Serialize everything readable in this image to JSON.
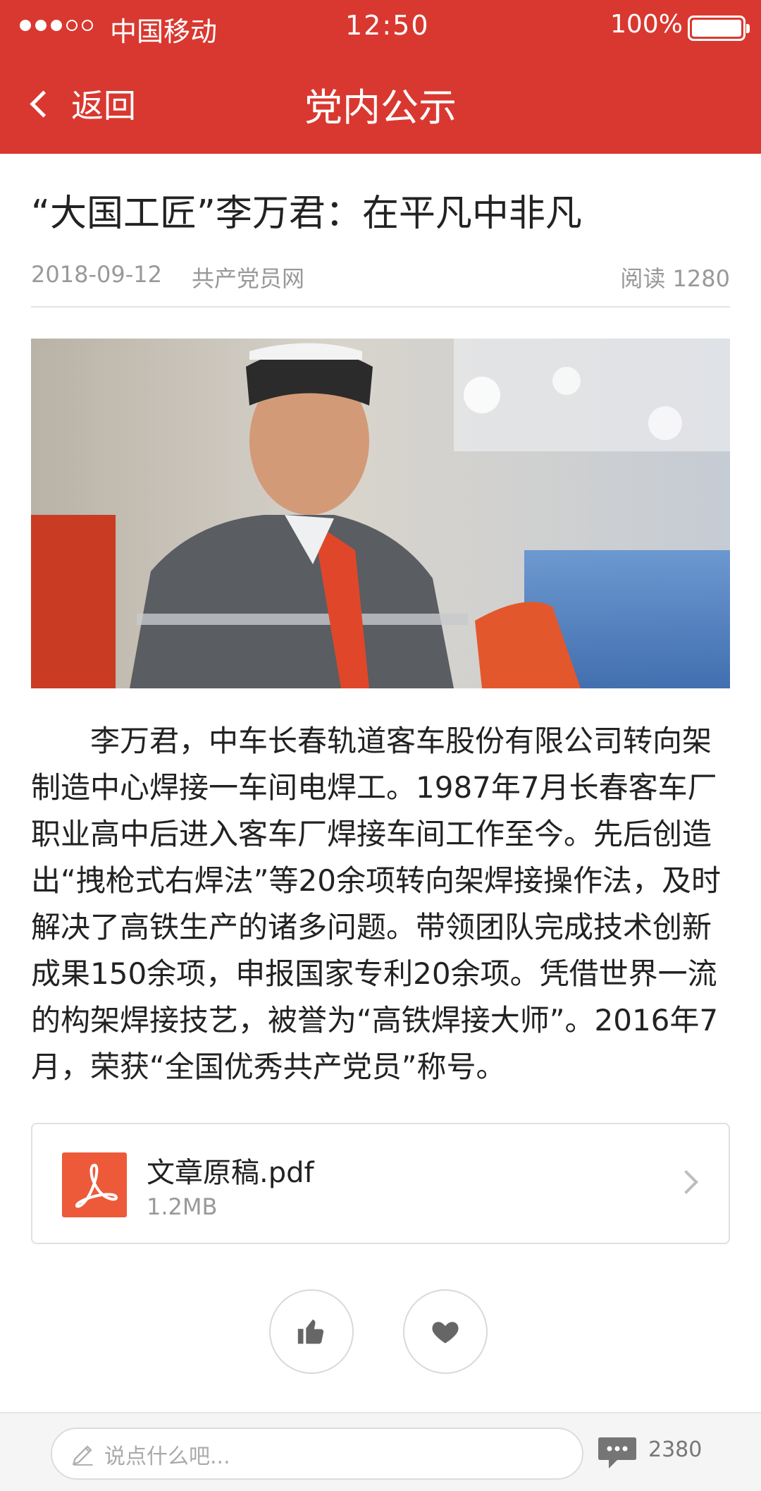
{
  "status_bar": {
    "carrier": "中国移动",
    "time": "12:50",
    "battery": "100%",
    "signal_filled": 3,
    "signal_total": 5
  },
  "nav": {
    "back_label": "返回",
    "title": "党内公示"
  },
  "article": {
    "title": "“大国工匠”李万君：在平凡中非凡",
    "date": "2018-09-12",
    "source": "共产党员网",
    "reads": "阅读 1280",
    "body": "李万君，中车长春轨道客车股份有限公司转向架制造中心焊接一车间电焊工。1987年7月长春客车厂职业高中后进入客车厂焊接车间工作至今。先后创造出“拽枪式右焊法”等20余项转向架焊接操作法，及时解决了高铁生产的诸多问题。带领团队完成技术创新成果150余项，申报国家专利20余项。凭借世界一流的构架焊接技艺，被誉为“高铁焊接大师”。2016年7月，荣获“全国优秀共产党员”称号。"
  },
  "attachment": {
    "name": "文章原稿.pdf",
    "size": "1.2MB",
    "icon": "pdf-icon"
  },
  "actions": {
    "like_icon": "thumbs-up-icon",
    "favorite_icon": "heart-icon"
  },
  "comment_bar": {
    "placeholder": "说点什么吧...",
    "count": "2380"
  },
  "colors": {
    "brand_red": "#d93830",
    "pdf_red": "#ec5a3a"
  }
}
